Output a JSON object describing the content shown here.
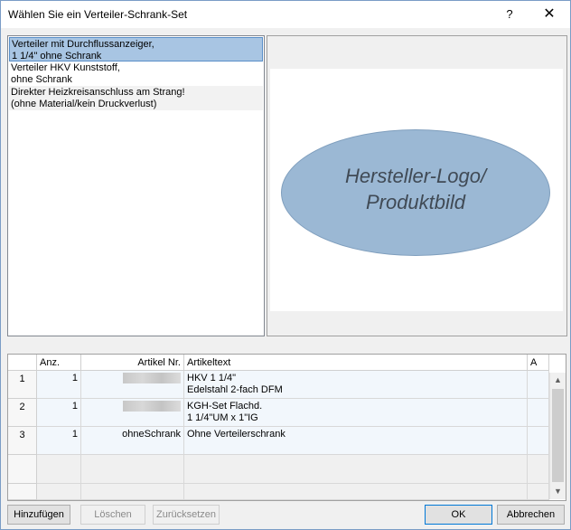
{
  "window": {
    "title": "Wählen Sie ein Verteiler-Schrank-Set",
    "help_label": "?",
    "close_label": "✕"
  },
  "list": {
    "items": [
      {
        "label": "Verteiler mit Durchflussanzeiger,\n1 1/4\" ohne Schrank",
        "selected": true
      },
      {
        "label": "Verteiler HKV Kunststoff,\nohne Schrank",
        "selected": false
      },
      {
        "label": "Direkter Heizkreisanschluss am Strang!\n(ohne Material/kein Druckverlust)",
        "selected": false
      }
    ]
  },
  "preview": {
    "logo_text": "Hersteller-Logo/\nProduktbild"
  },
  "grid": {
    "columns": {
      "anz": "Anz.",
      "artikel_nr": "Artikel Nr.",
      "artikeltext": "Artikeltext",
      "a": "A"
    },
    "rows": [
      {
        "num": "1",
        "anz": "1",
        "artikel_nr": "",
        "artikeltext": " HKV 1 1/4\"\nEdelstahl 2-fach DFM",
        "a": ""
      },
      {
        "num": "2",
        "anz": "1",
        "artikel_nr": "",
        "artikeltext": " KGH-Set Flachd.\n1 1/4\"UM x 1\"IG",
        "a": ""
      },
      {
        "num": "3",
        "anz": "1",
        "artikel_nr": "ohneSchrank",
        "artikeltext": "Ohne Verteilerschrank",
        "a": ""
      }
    ]
  },
  "buttons": {
    "add": "Hinzufügen",
    "delete": "Löschen",
    "reset": "Zurücksetzen",
    "ok": "OK",
    "cancel": "Abbrechen"
  }
}
